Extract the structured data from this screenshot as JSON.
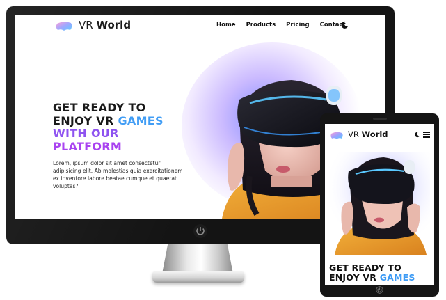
{
  "brand": {
    "name_light": "VR",
    "name_bold": "World"
  },
  "nav": {
    "items": [
      "Home",
      "Products",
      "Pricing",
      "Contact"
    ]
  },
  "hero": {
    "title_part1": "GET READY TO",
    "title_part2": "ENJOY VR",
    "title_highlight1": "GAMES",
    "title_highlight2": "WITH OUR",
    "title_highlight3": "PLATFORM",
    "description": "Lorem, ipsum dolor sit amet consectetur adipisicing elit. Ab molestias quia exercitationem ex inventore labore beatae cumque et quaerat voluptas?"
  },
  "icons": {
    "logo": "vr-headset-logo-icon",
    "theme_toggle": "moon-icon",
    "menu": "hamburger-menu-icon",
    "power": "power-icon",
    "home": "home-button-icon"
  },
  "colors": {
    "accent_blue": "#3d9bf5",
    "accent_purple": "#a63cf0",
    "glow": "#6e78ff",
    "hoodie": "#e89a2c",
    "headset": "#1a1a22"
  }
}
